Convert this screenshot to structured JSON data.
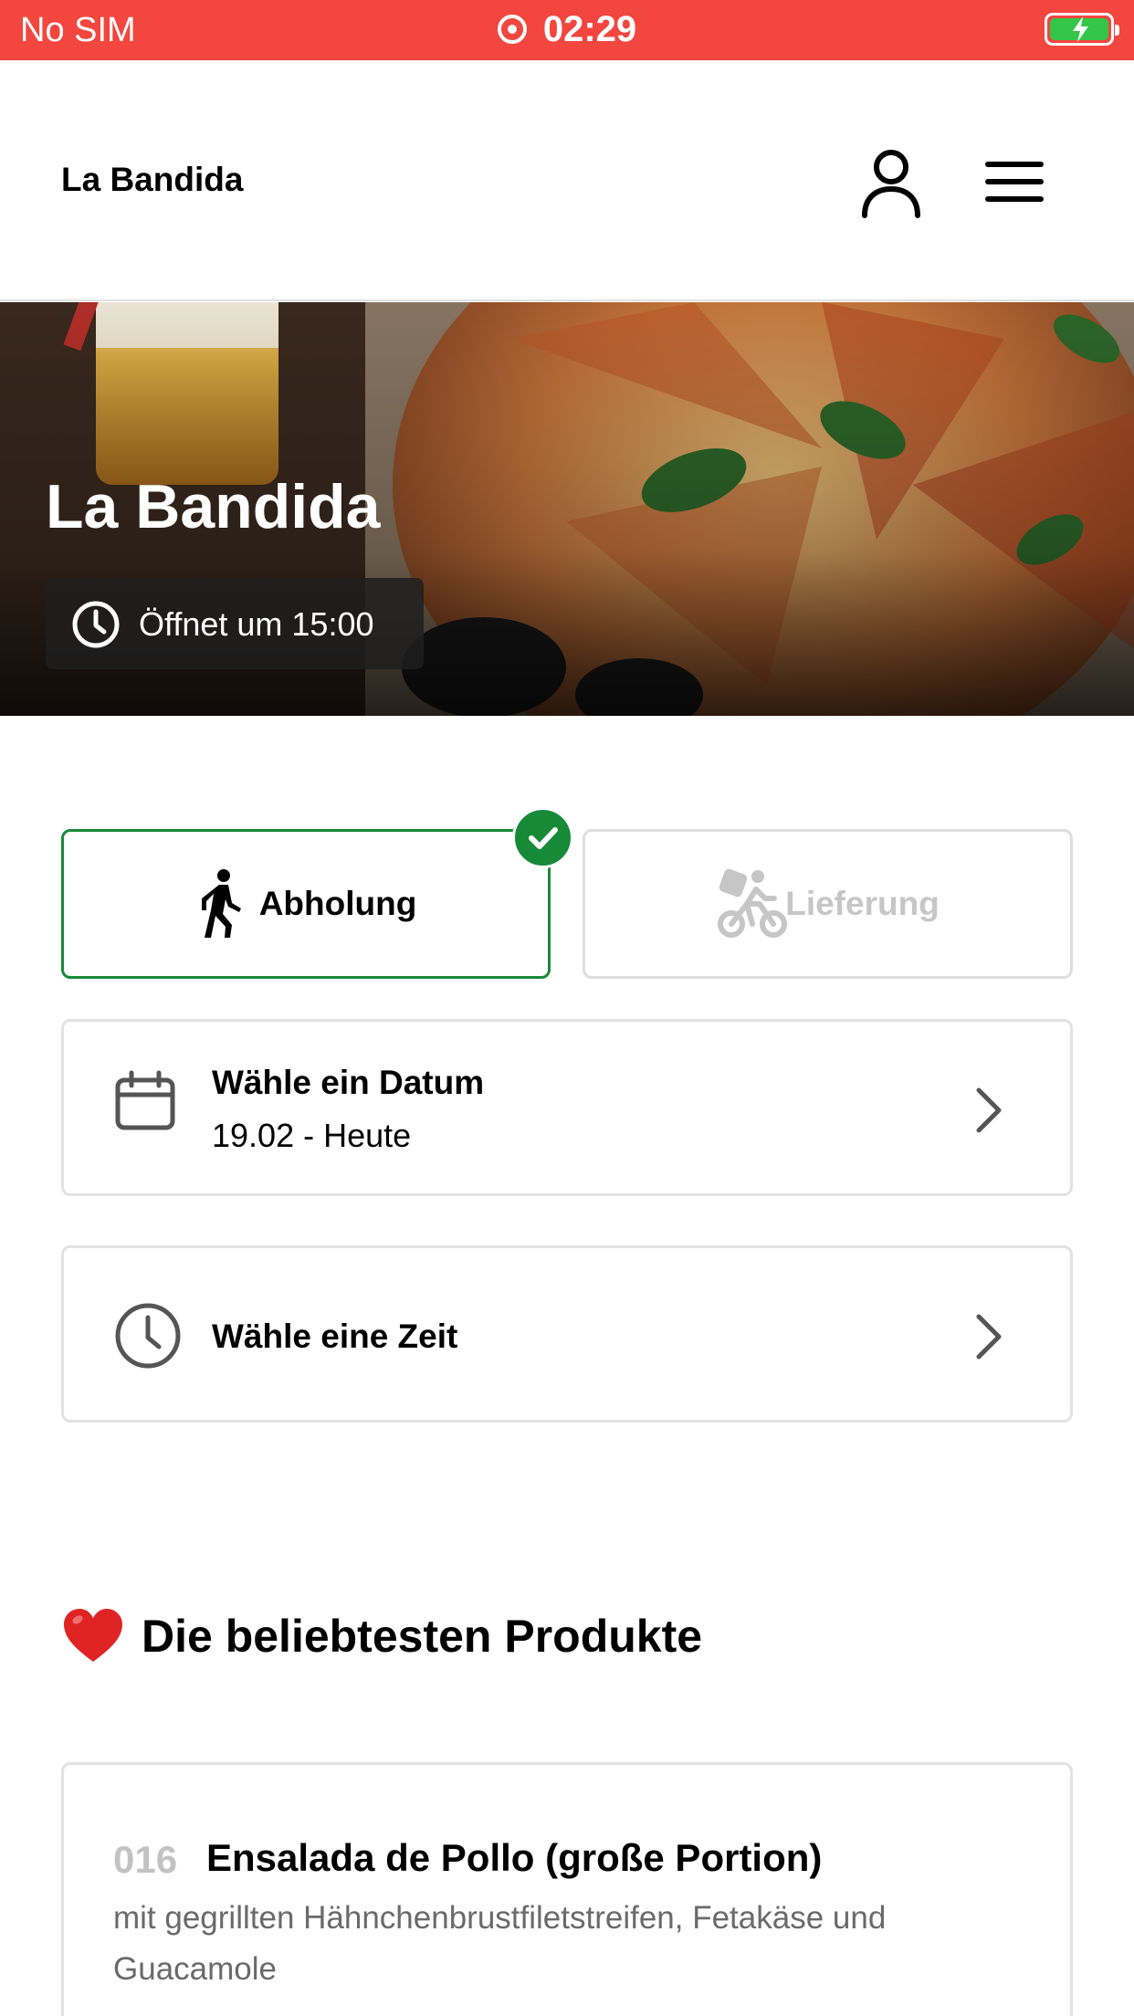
{
  "status_bar": {
    "carrier": "No SIM",
    "time": "02:29",
    "recording_icon": "record-icon",
    "battery_icon": "battery-charging-icon",
    "background_color": "#f2463e"
  },
  "header": {
    "brand": "La Bandida",
    "user_icon": "user-icon",
    "menu_icon": "hamburger-menu-icon"
  },
  "hero": {
    "title": "La Bandida",
    "hours_icon": "clock-icon",
    "hours_text": "Öffnet um 15:00"
  },
  "order_mode": {
    "pickup_label": "Abholung",
    "pickup_icon": "walking-person-icon",
    "pickup_selected": true,
    "delivery_label": "Lieferung",
    "delivery_icon": "bike-delivery-icon",
    "delivery_enabled": false,
    "accent_color": "#178a37"
  },
  "date_picker": {
    "icon": "calendar-icon",
    "title": "Wähle ein Datum",
    "value": "19.02 - Heute"
  },
  "time_picker": {
    "icon": "clock-icon",
    "title": "Wähle eine Zeit"
  },
  "popular": {
    "icon": "red-heart-icon",
    "title": "Die beliebtesten Produkte",
    "products": [
      {
        "number": "016",
        "name": "Ensalada de Pollo (große Portion)",
        "description": "mit gegrillten Hähnchenbrustfiletstreifen, Fetakäse und Guacamole"
      }
    ]
  }
}
